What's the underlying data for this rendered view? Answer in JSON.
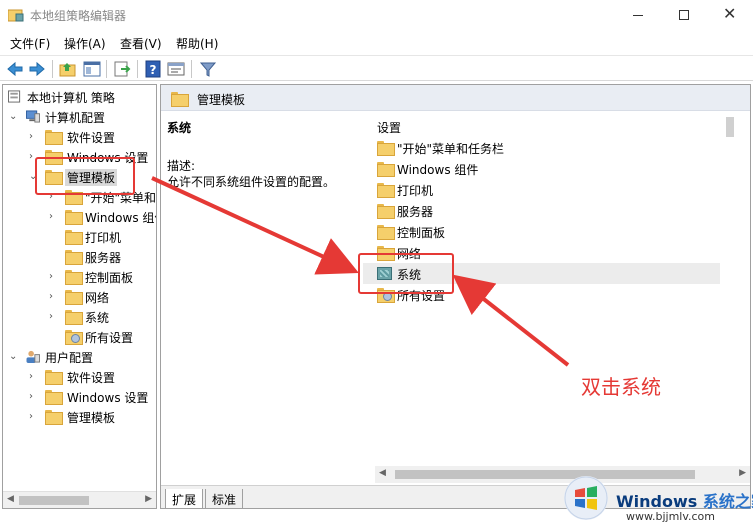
{
  "window": {
    "title": "本地组策略编辑器",
    "min_icon": "minimize-icon",
    "max_icon": "maximize-icon",
    "close_icon": "close-icon"
  },
  "menu": [
    {
      "label": "文件(F)"
    },
    {
      "label": "操作(A)"
    },
    {
      "label": "查看(V)"
    },
    {
      "label": "帮助(H)"
    }
  ],
  "toolbar": {
    "icons": [
      "back-arrow-icon",
      "forward-arrow-icon",
      "folder-up-icon",
      "show-hide-tree-icon",
      "export-list-icon",
      "help-icon",
      "properties-icon",
      "filter-icon"
    ]
  },
  "tree": {
    "root": "本地计算机 策略",
    "computer_config": "计算机配置",
    "software_settings": "软件设置",
    "windows_settings": "Windows 设置",
    "admin_templates": "管理模板",
    "start_menu": "\"开始\"菜单和任务栏",
    "windows_components": "Windows 组件",
    "printers": "打印机",
    "servers": "服务器",
    "control_panel": "控制面板",
    "network": "网络",
    "system": "系统",
    "all_settings": "所有设置",
    "user_config": "用户配置",
    "user_software_settings": "软件设置",
    "user_windows_settings": "Windows 设置",
    "user_admin_templates": "管理模板"
  },
  "right": {
    "header": "管理模板",
    "desc_title": "系统",
    "desc_label": "描述:",
    "desc_text": "允许不同系统组件设置的配置。",
    "column_header": "设置",
    "items": [
      {
        "label": "\"开始\"菜单和任务栏",
        "icon": "folder-icon"
      },
      {
        "label": "Windows 组件",
        "icon": "folder-icon"
      },
      {
        "label": "打印机",
        "icon": "folder-icon"
      },
      {
        "label": "服务器",
        "icon": "folder-icon"
      },
      {
        "label": "控制面板",
        "icon": "folder-icon"
      },
      {
        "label": "网络",
        "icon": "folder-icon"
      },
      {
        "label": "系统",
        "icon": "policy-icon"
      },
      {
        "label": "所有设置",
        "icon": "all-settings-icon"
      }
    ]
  },
  "tabs": [
    {
      "label": "扩展"
    },
    {
      "label": "标准"
    }
  ],
  "annotation": {
    "text": "双击系统",
    "color": "#e53935"
  },
  "watermark": {
    "brand_main": "Windows",
    "brand_accent": "系统之家",
    "url": "www.bjjmlv.com"
  },
  "colors": {
    "accent_red": "#e53935",
    "folder_yellow": "#f5cf6b",
    "header_bg": "#e9edf3",
    "watermark_blue": "#0a3c7d"
  }
}
